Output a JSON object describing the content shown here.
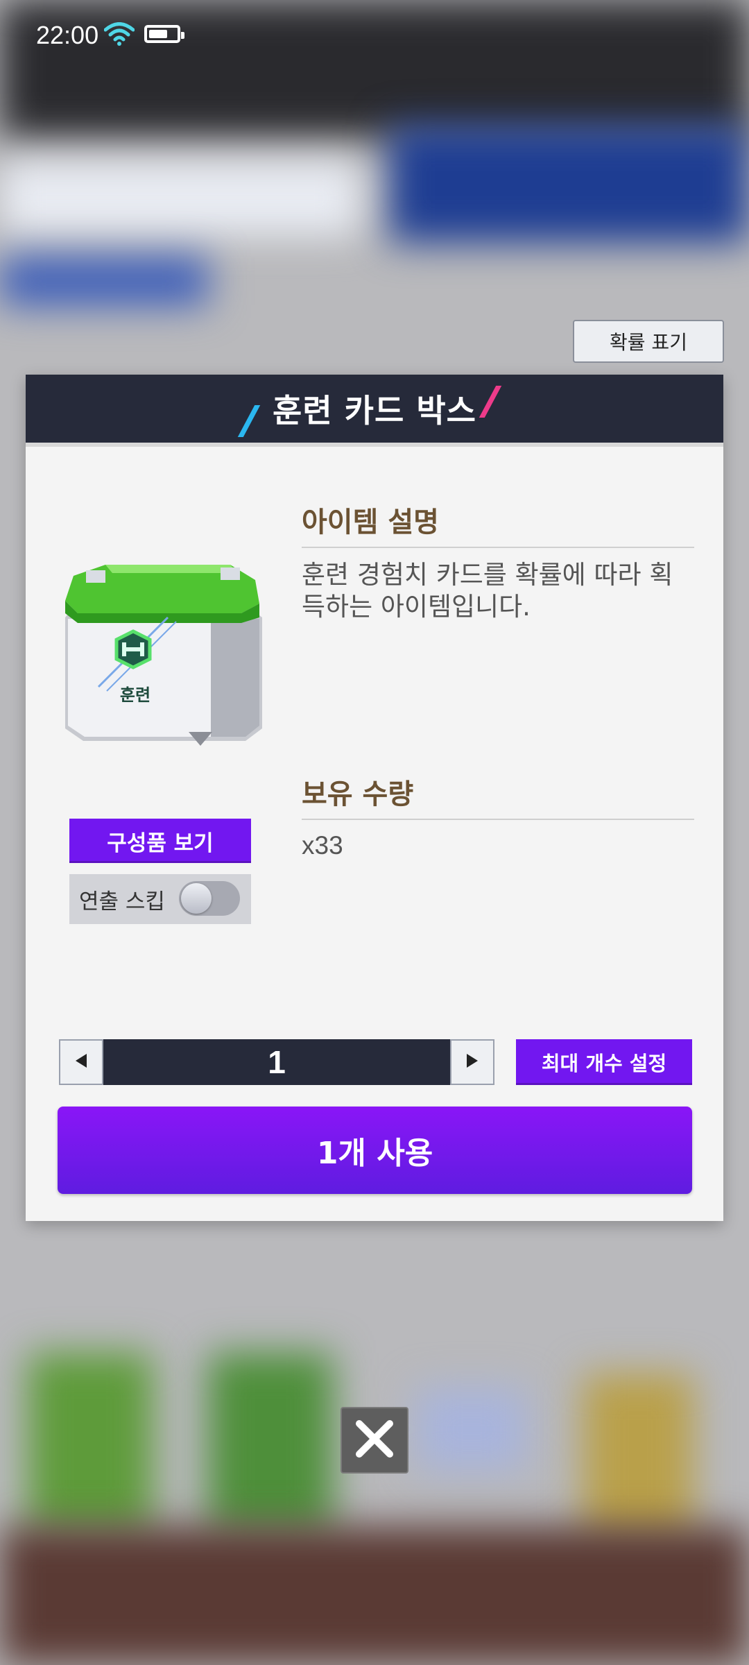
{
  "status_bar": {
    "time": "22:00"
  },
  "probability_button": {
    "label": "확률 표기"
  },
  "panel": {
    "title": "훈련 카드 박스",
    "item_image": {
      "badge_text": "훈련"
    },
    "description": {
      "heading": "아이템 설명",
      "text": "훈련 경험치 카드를 확률에 따라 획득하는 아이템입니다."
    },
    "owned": {
      "heading": "보유 수량",
      "value": "x33"
    },
    "components_button": {
      "label": "구성품 보기"
    },
    "effect_skip": {
      "label": "연출 스킵",
      "enabled": false
    },
    "quantity": {
      "value": "1"
    },
    "max_button": {
      "label": "최대 개수 설정"
    },
    "use_button": {
      "label": "1개 사용"
    }
  },
  "colors": {
    "accent_purple": "#7217f0",
    "header_navy": "#262a3a",
    "section_brown": "#6b5233"
  },
  "icons": [
    "wifi-icon",
    "battery-icon",
    "left-arrow-icon",
    "right-arrow-icon",
    "close-icon"
  ]
}
